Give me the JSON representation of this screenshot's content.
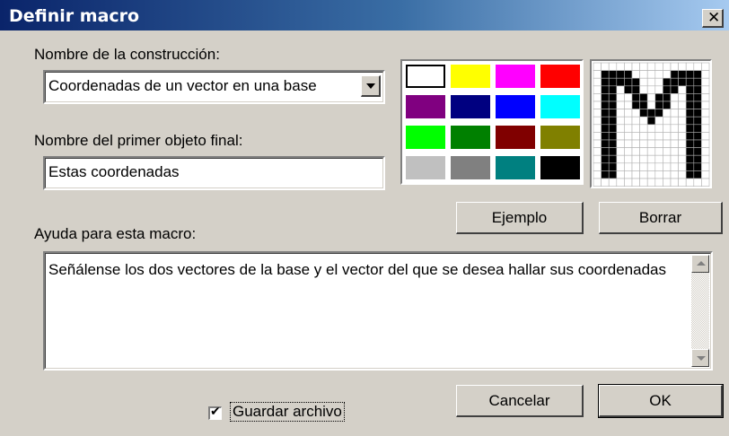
{
  "window": {
    "title": "Definir macro",
    "close_glyph": "✕"
  },
  "construction_name": {
    "label": "Nombre de la construcción:",
    "value": "Coordenadas de un vector en una base"
  },
  "first_object": {
    "label": "Nombre del primer objeto final:",
    "value": "Estas coordenadas"
  },
  "palette": {
    "colors": [
      "#ffffff",
      "#ffff00",
      "#ff00ff",
      "#ff0000",
      "#800080",
      "#000080",
      "#0000ff",
      "#00ffff",
      "#00ff00",
      "#008000",
      "#800000",
      "#808000",
      "#c0c0c0",
      "#808080",
      "#008080",
      "#000000"
    ],
    "selected": "#ffffff"
  },
  "macro_icon": {
    "name": "macro-letter-m-icon",
    "pattern": [
      "...............",
      ".####.....####.",
      ".#####...#####.",
      ".##.##...##.##.",
      ".##..##.##..##.",
      ".##..##.##..##.",
      ".##...###...##.",
      ".##....#....##.",
      ".##.........##.",
      ".##.........##.",
      ".##.........##.",
      ".##.........##.",
      ".##.........##.",
      ".##.........##.",
      ".##.........##.",
      "..............."
    ]
  },
  "buttons": {
    "example": "Ejemplo",
    "clear": "Borrar",
    "cancel": "Cancelar",
    "ok": "OK"
  },
  "help": {
    "label": "Ayuda para esta macro:",
    "text": "Señálense los dos vectores de la base y el vector del que se desea hallar sus coordenadas"
  },
  "save_file": {
    "label": "Guardar archivo",
    "checked": true,
    "check_glyph": "✔"
  }
}
